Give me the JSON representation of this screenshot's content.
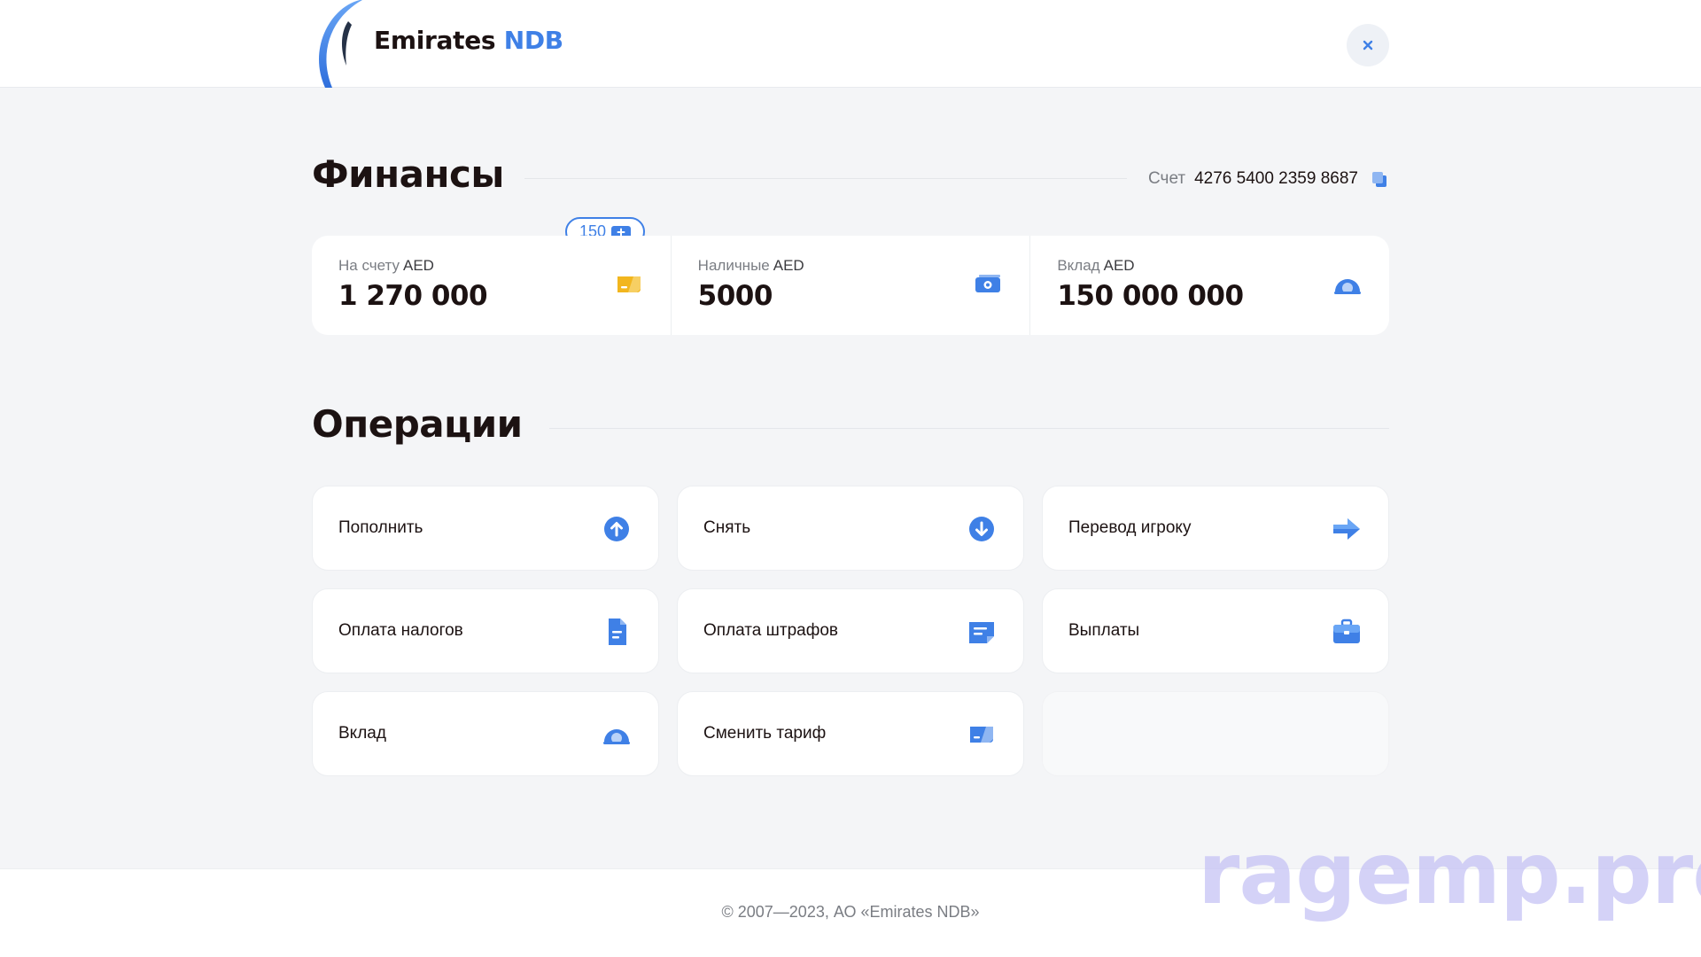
{
  "header": {
    "logo_word1": "Emirates",
    "logo_word2": "NDB",
    "close_icon": "close-icon"
  },
  "finances": {
    "title": "Финансы",
    "account_label": "Счет",
    "account_number": "4276 5400 2359 8687",
    "bonus": {
      "value": "150",
      "icon": "card-plus-icon"
    },
    "cells": [
      {
        "label": "На счету",
        "currency": "AED",
        "value": "1 270 000",
        "icon": "card-icon"
      },
      {
        "label": "Наличные",
        "currency": "AED",
        "value": "5000",
        "icon": "cash-icon"
      },
      {
        "label": "Вклад",
        "currency": "AED",
        "value": "150 000 000",
        "icon": "deposit-icon"
      }
    ]
  },
  "operations": {
    "title": "Операции",
    "items": [
      {
        "label": "Пополнить",
        "icon": "arrow-up-circle-icon"
      },
      {
        "label": "Снять",
        "icon": "arrow-down-circle-icon"
      },
      {
        "label": "Перевод игроку",
        "icon": "arrow-right-icon"
      },
      {
        "label": "Оплата налогов",
        "icon": "document-icon"
      },
      {
        "label": "Оплата штрафов",
        "icon": "ticket-icon"
      },
      {
        "label": "Выплаты",
        "icon": "briefcase-icon"
      },
      {
        "label": "Вклад",
        "icon": "deposit-icon"
      },
      {
        "label": "Сменить тариф",
        "icon": "card-icon"
      }
    ]
  },
  "footer": {
    "copyright": "© 2007—2023, АО «Emirates NDB»"
  },
  "watermark": "ragemp.pro",
  "colors": {
    "accent": "#3f80e6",
    "card_yellow": "#f2b61e",
    "background": "#f4f5f7"
  }
}
